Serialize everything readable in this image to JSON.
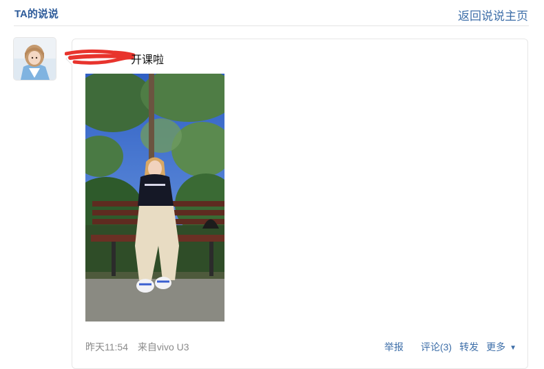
{
  "header": {
    "title": "TA的说说",
    "back_link": "返回说说主页"
  },
  "post": {
    "text": "开课啦",
    "timestamp": "昨天11:54",
    "source": "来自vivo U3"
  },
  "actions": {
    "report": "举报",
    "comment": "评论(3)",
    "share": "转发",
    "more": "更多",
    "more_caret": "▼"
  },
  "colors": {
    "link": "#3d6ea8",
    "title": "#2d5b9a",
    "meta": "#8a8a8a",
    "redaction": "#e8342d"
  },
  "icons": {
    "more_caret": "caret-down-icon"
  }
}
